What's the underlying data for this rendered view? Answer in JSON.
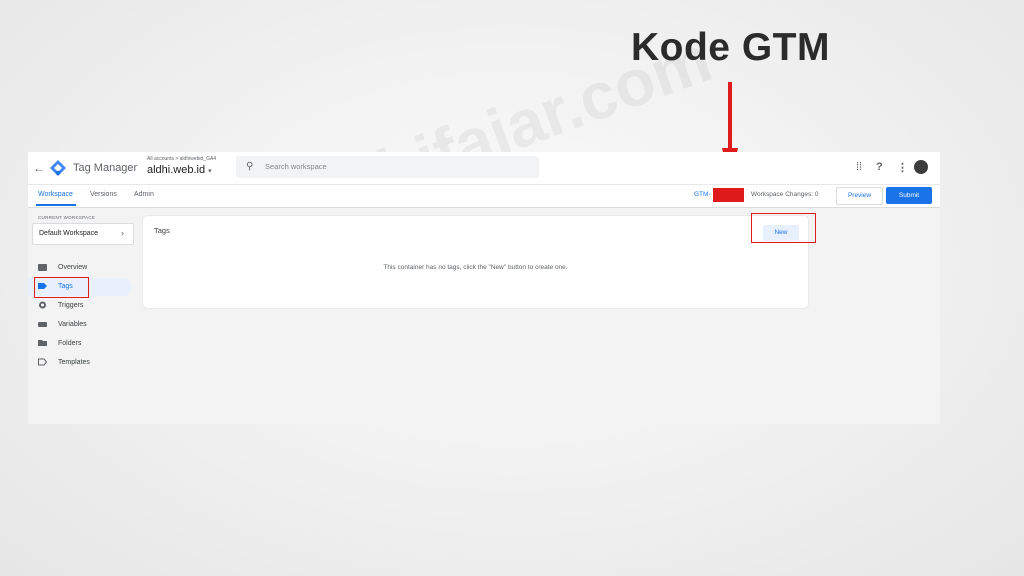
{
  "annotation": {
    "headline": "Kode GTM"
  },
  "app": {
    "product_name": "Tag Manager",
    "breadcrumb": "All accounts > aldhiwebid_GA4",
    "container_name": "aldhi.web.id",
    "search_placeholder": "Search workspace",
    "tabs": [
      {
        "label": "Workspace",
        "active": true
      },
      {
        "label": "Versions",
        "active": false
      },
      {
        "label": "Admin",
        "active": false
      }
    ],
    "container_id_prefix": "GTM-",
    "workspace_changes": "Workspace Changes: 0",
    "preview_label": "Preview",
    "submit_label": "Submit",
    "icons": [
      "apps-grid-icon",
      "help-icon",
      "more-vert-icon",
      "avatar"
    ]
  },
  "sidebar": {
    "workspace_label": "CURRENT WORKSPACE",
    "workspace_name": "Default Workspace",
    "items": [
      {
        "label": "Overview",
        "icon": "overview-icon"
      },
      {
        "label": "Tags",
        "icon": "tag-icon",
        "active": true
      },
      {
        "label": "Triggers",
        "icon": "trigger-icon"
      },
      {
        "label": "Variables",
        "icon": "variables-icon"
      },
      {
        "label": "Folders",
        "icon": "folder-icon"
      },
      {
        "label": "Templates",
        "icon": "template-icon"
      }
    ]
  },
  "main": {
    "card_title": "Tags",
    "new_button": "New",
    "empty_message": "This container has no tags, click the \"New\" button to create one."
  },
  "watermark": "www.aldhifajar.com",
  "colors": {
    "accent": "#1a73e8",
    "highlight": "#e01b1b"
  }
}
